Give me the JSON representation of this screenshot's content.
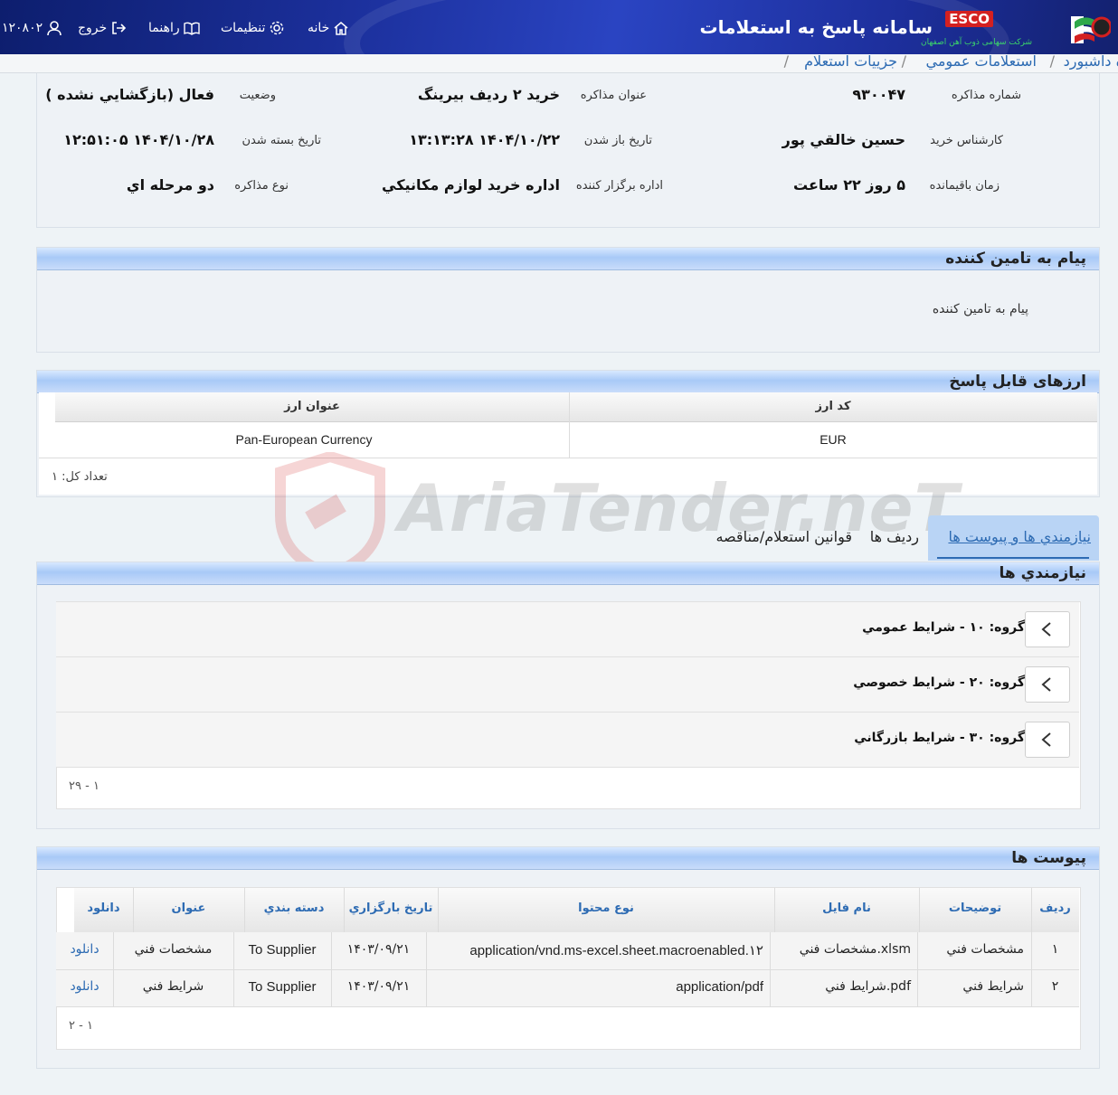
{
  "header": {
    "app_title": "سامانه پاسخ به استعلامات",
    "esco": "ESCO",
    "company": "شرکت سهامی ذوب آهن اصفهان",
    "nav": {
      "home": "خانه",
      "settings": "تنظیمات",
      "help": "راهنما",
      "logout": "خروج",
      "user": "۱۲۰۸۰۲"
    }
  },
  "breadcrumb": [
    "ه داشبورد",
    "استعلامات عمومي",
    "جزييات استعلام"
  ],
  "details": {
    "number_label": "شماره مذاکره",
    "number_value": "۹۳۰۰۴۷",
    "title_label": "عنوان مذاکره",
    "title_value": "خرید ۲ ردیف بیرینگ",
    "status_label": "وضعيت",
    "status_value": "فعال (بازگشايي نشده )",
    "expert_label": "کارشناس خريد",
    "expert_value": "حسين خالقي پور",
    "open_label": "تاريخ باز شدن",
    "open_value": "۱۴۰۴/۱۰/۲۲ ۱۳:۱۳:۲۸",
    "close_label": "تاريخ بسته شدن",
    "close_value": "۱۴۰۴/۱۰/۲۸ ۱۲:۵۱:۰۵",
    "remaining_label": "زمان باقيمانده",
    "remaining_value": "۵ روز ۲۲ ساعت",
    "dept_label": "اداره برگزار کننده",
    "dept_value": "اداره خريد لوازم مکانيکي",
    "type_label": "نوع مذاکره",
    "type_value": "دو مرحله اي"
  },
  "supplier_message": {
    "title": "پيام به تامين کننده",
    "label": "پيام به تامين کننده"
  },
  "currencies": {
    "title": "ارزهای قابل پاسخ",
    "headers": [
      "کد ارز",
      "عنوان ارز"
    ],
    "rows": [
      [
        "EUR",
        "Pan-European Currency"
      ]
    ],
    "total": "تعداد کل: ۱"
  },
  "tabs": [
    "نيازمندي ها و پیوست ها",
    "رديف ها",
    "قوانين استعلام/مناقصه"
  ],
  "requirements": {
    "title": "نيازمندي ها",
    "groups": [
      "گروه: ۱۰ - شرايط عمومي",
      "گروه: ۲۰ - شرايط خصوصي",
      "گروه: ۳۰ - شرايط بازرگاني"
    ],
    "pager": "۱ - ۲۹"
  },
  "attachments": {
    "title": "پيوست ها",
    "headers": [
      "رديف",
      "توضيحات",
      "نام فايل",
      "نوع محتوا",
      "تاريخ بارگزاري",
      "دسته بندي",
      "عنوان",
      "دانلود"
    ],
    "rows": [
      [
        "۱",
        "مشخصات فني",
        "مشخصات فني.xlsm",
        "application/vnd.ms-excel.sheet.macroenabled.۱۲",
        "۱۴۰۳/۰۹/۲۱",
        "To Supplier",
        "مشخصات فني",
        "دانلود"
      ],
      [
        "۲",
        "شرايط فني",
        "شرايط فني.pdf",
        "application/pdf",
        "۱۴۰۳/۰۹/۲۱",
        "To Supplier",
        "شرايط فني",
        "دانلود"
      ]
    ],
    "pager": "۱ - ۲"
  },
  "watermark": "AriaTender.neT",
  "colors": {
    "header": "#1b2f9a",
    "link": "#2d6bb3",
    "panel_head": "#a8c9f7",
    "esco_red": "#d42020"
  }
}
